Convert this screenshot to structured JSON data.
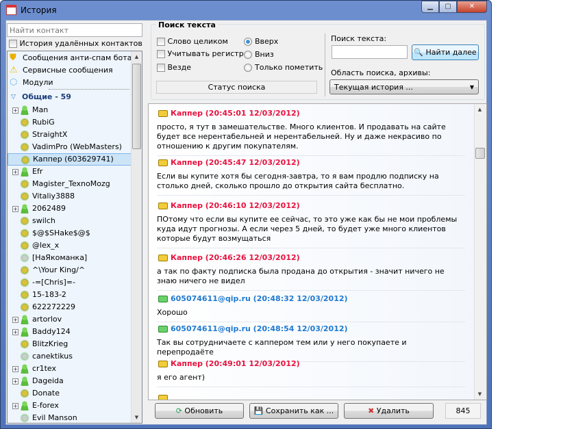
{
  "window": {
    "title": "История",
    "buttons": [
      "minimize",
      "maximize",
      "close"
    ]
  },
  "sidebar": {
    "find_placeholder": "Найти контакт",
    "deleted_history_label": "История удалённых контактов",
    "special_items": [
      {
        "label": "Сообщения анти-спам бота",
        "icon": "shield-icon"
      },
      {
        "label": "Сервисные сообщения",
        "icon": "warning-icon"
      },
      {
        "label": "Модули",
        "icon": "modules-icon"
      }
    ],
    "group_label": "Общие - 59",
    "contacts": [
      {
        "name": "Man",
        "type": "person",
        "expandable": true
      },
      {
        "name": "RubiG",
        "type": "icq"
      },
      {
        "name": "StraightX",
        "type": "icq"
      },
      {
        "name": "VadimPro (WebMasters)",
        "type": "icq"
      },
      {
        "name": "Каппер (603629741)",
        "type": "icq",
        "selected": true
      },
      {
        "name": "Efr",
        "type": "person",
        "expandable": true
      },
      {
        "name": "Magister_TexnoMozg",
        "type": "icq"
      },
      {
        "name": "Vitaliy3888",
        "type": "icq"
      },
      {
        "name": "2062489",
        "type": "person",
        "expandable": true
      },
      {
        "name": "swilch",
        "type": "icq"
      },
      {
        "name": "$@$SHake$@$",
        "type": "icq"
      },
      {
        "name": "@lex_x",
        "type": "icq"
      },
      {
        "name": "[НаЯкоманка]",
        "type": "off"
      },
      {
        "name": "^\\Your King/^",
        "type": "icq"
      },
      {
        "name": "-=[Chris]=-",
        "type": "icq"
      },
      {
        "name": "15-183-2",
        "type": "icq"
      },
      {
        "name": "622272229",
        "type": "icq"
      },
      {
        "name": "artorlov",
        "type": "person",
        "expandable": true
      },
      {
        "name": "Baddy124",
        "type": "person",
        "expandable": true
      },
      {
        "name": "BlitzKrieg",
        "type": "icq"
      },
      {
        "name": "canektikus",
        "type": "off"
      },
      {
        "name": "cr1tex",
        "type": "person",
        "expandable": true
      },
      {
        "name": "Dageida",
        "type": "person",
        "expandable": true
      },
      {
        "name": "Donate",
        "type": "icq"
      },
      {
        "name": "E-forex",
        "type": "person",
        "expandable": true
      },
      {
        "name": "Evil Manson",
        "type": "off"
      }
    ]
  },
  "search": {
    "group_title": "Поиск текста",
    "whole_word": "Слово целиком",
    "match_case": "Учитывать регистр",
    "everywhere": "Везде",
    "up": "Вверх",
    "down": "Вниз",
    "mark_only": "Только пометить",
    "status": "Статус поиска",
    "text_label": "Поиск текста:",
    "text_value": "",
    "find_next": "Найти далее",
    "scope_label": "Область поиска, архивы:",
    "scope_value": "Текущая история ..."
  },
  "messages": [
    {
      "sender": "Каппер (20:45:01 12/03/2012)",
      "side": "red",
      "text": "просто, я тут в замешательстве. Много клиентов. И продавать на сайте будет все нерентабельней и нерентабельней. Ну и даже некрасиво по отношению к другим покупателям."
    },
    {
      "sender": "Каппер (20:45:47 12/03/2012)",
      "side": "red",
      "text": "Если вы купите хотя бы сегодня-завтра, то я вам продлю подписку на столько дней, сколько прошло до открытия сайта бесплатно."
    },
    {
      "sender": "Каппер (20:46:10 12/03/2012)",
      "side": "red",
      "text": "ПОтому что если вы купите ее сейчас, то это уже как бы не мои проблемы куда идут прогнозы. А если через 5 дней, то будет уже много клиентов которые будут возмущаться"
    },
    {
      "sender": "Каппер (20:46:26 12/03/2012)",
      "side": "red",
      "text": "а так по факту подписка была продана до открытия - значит ничего не знаю ничего не видел"
    },
    {
      "sender": "605074611@qip.ru (20:48:32 12/03/2012)",
      "side": "blue",
      "text": "Хорошо"
    },
    {
      "sender": "605074611@qip.ru (20:48:54 12/03/2012)",
      "side": "blue",
      "text": "Так вы сотрудничаете с каппером тем или у него покупаете и перепродаёте"
    },
    {
      "sender": "Каппер (20:49:01 12/03/2012)",
      "side": "red",
      "text": "я его агент)"
    }
  ],
  "footer": {
    "refresh": "Обновить",
    "save_as": "Сохранить как ...",
    "delete": "Удалить",
    "count": "845"
  }
}
